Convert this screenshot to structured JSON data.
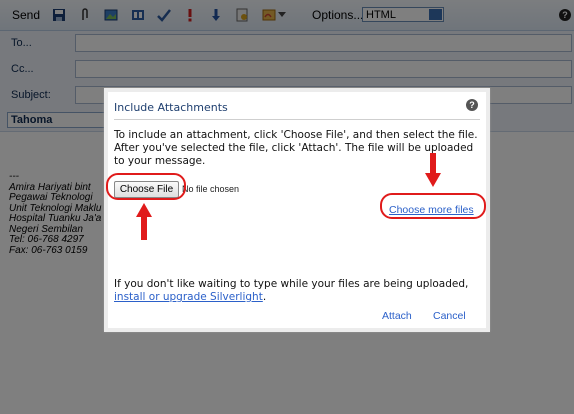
{
  "toolbar": {
    "send_label": "Send",
    "options_label": "Options...",
    "format_value": "HTML",
    "icons": [
      "save-icon",
      "attach-icon",
      "insert-image-icon",
      "address-book-icon",
      "spellcheck-icon",
      "importance-high-icon",
      "importance-low-icon",
      "permissions-icon",
      "signature-icon"
    ]
  },
  "fields": {
    "to_label": "To...",
    "cc_label": "Cc...",
    "subject_label": "Subject:"
  },
  "format_bar": {
    "font_value": "Tahoma"
  },
  "body_text": {
    "signature": "---\nAmira Hariyati bint\nPegawai Teknologi\nUnit Teknologi Maklu\nHospital Tuanku Ja'a\nNegeri Sembilan\nTel: 06-768 4297\nFax: 06-763 0159"
  },
  "dialog": {
    "title": "Include Attachments",
    "instructions": "To include an attachment, click 'Choose File', and then select the file. After you've selected the file, click 'Attach'. The file will be uploaded to your message.",
    "choose_file_label": "Choose File",
    "no_file_text": "No file chosen",
    "choose_more_label": "Choose more files",
    "footer_text": "If you don't like waiting to type while your files are being uploaded, ",
    "footer_link": "install or upgrade Silverlight",
    "footer_end": ".",
    "attach_label": "Attach",
    "cancel_label": "Cancel"
  },
  "colors": {
    "annotation": "#e01b1b",
    "link": "#2b60c9",
    "toolbar_bg": "#dfeaf6"
  }
}
